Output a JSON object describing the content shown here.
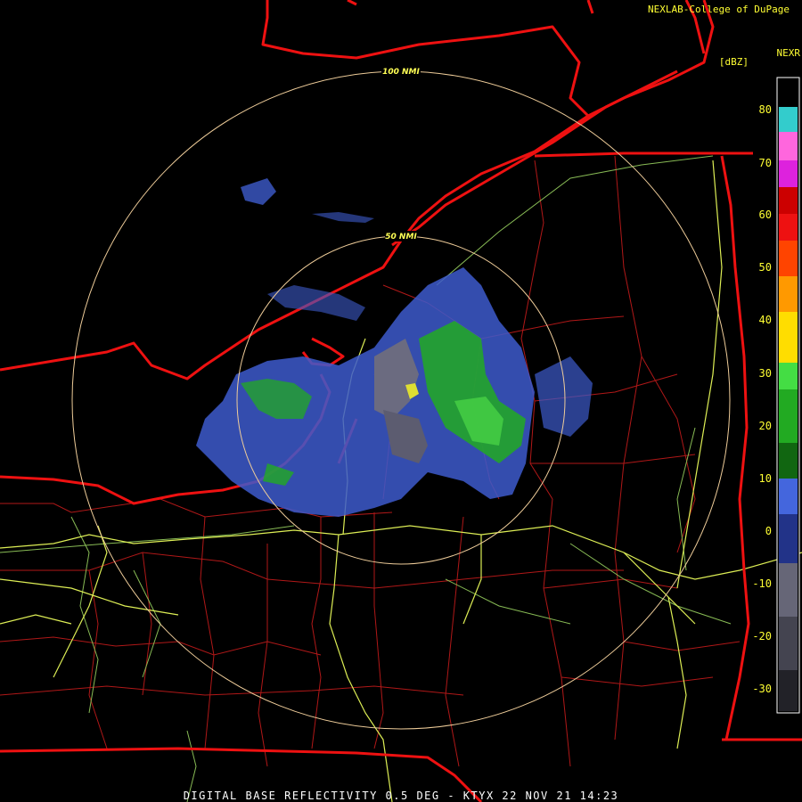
{
  "header": {
    "credit": "NEXLAB-College of DuPage",
    "product": "NEXR",
    "units": "[dBZ]"
  },
  "footer": {
    "caption": "DIGITAL BASE REFLECTIVITY 0.5 DEG - KTYX 22 NOV 21 14:23"
  },
  "range_rings": [
    {
      "label": "100 NMI"
    },
    {
      "label": "50 NMI"
    }
  ],
  "legend": {
    "ticks": [
      "80",
      "70",
      "60",
      "50",
      "40",
      "30",
      "20",
      "10",
      "0",
      "-10",
      "-20",
      "-30"
    ],
    "colors": {
      "cyan": "#33cccc",
      "magenta": "#e020e0",
      "pink": "#ff66dd",
      "red": "#ee1010",
      "orange": "#ff8000",
      "yellow": "#ffff00",
      "green": "#22bb22",
      "darkgreen": "#117711",
      "blue": "#3355cc",
      "navy": "#223399",
      "gray": "#666677",
      "dark": "#222222"
    }
  },
  "colors": {
    "state_border": "#ff2222",
    "county_border": "#cc2020",
    "highway": "#ddee55",
    "river": "#88cc66",
    "ring": "#eecc99"
  }
}
